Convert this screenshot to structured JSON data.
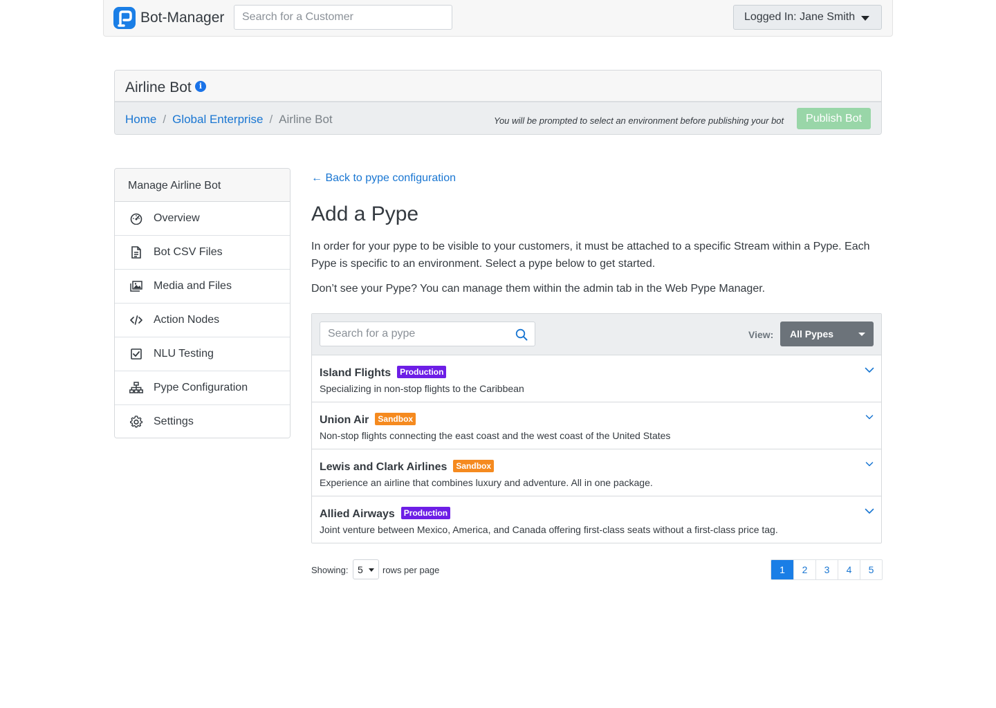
{
  "topbar": {
    "brand": "Bot-Manager",
    "search_placeholder": "Search for a Customer",
    "user_label": "Logged In: Jane Smith"
  },
  "header": {
    "title": "Airline Bot",
    "breadcrumb": [
      "Home",
      "Global Enterprise",
      "Airline Bot"
    ],
    "publish_note": "You will be prompted to select an environment before publishing your bot",
    "publish_label": "Publish Bot"
  },
  "sidebar": {
    "title": "Manage Airline Bot",
    "items": [
      {
        "label": "Overview",
        "icon": "gauge-icon"
      },
      {
        "label": "Bot CSV Files",
        "icon": "file-icon"
      },
      {
        "label": "Media and Files",
        "icon": "images-icon"
      },
      {
        "label": "Action Nodes",
        "icon": "code-icon"
      },
      {
        "label": "NLU Testing",
        "icon": "checkbox-icon"
      },
      {
        "label": "Pype Configuration",
        "icon": "sitemap-icon"
      },
      {
        "label": "Settings",
        "icon": "gear-icon"
      }
    ]
  },
  "main": {
    "back_label": "← Back to pype configuration",
    "title": "Add a Pype",
    "intro": "In order for your pype to be visible to your customers, it must be attached to a specific Stream within a Pype. Each Pype is specific to an environment. Select a pype below to get started.",
    "intro2": "Don’t see your Pype? You can manage them within the admin tab in the Web Pype Manager.",
    "search_placeholder": "Search for a pype",
    "view_label": "View:",
    "view_value": "All Pypes",
    "pypes": [
      {
        "name": "Island Flights",
        "env": "Production",
        "desc": "Specializing in non-stop flights to the Caribbean"
      },
      {
        "name": "Union Air",
        "env": "Sandbox",
        "desc": "Non-stop flights connecting the east coast and the west coast of the United States"
      },
      {
        "name": "Lewis and Clark Airlines",
        "env": "Sandbox",
        "desc": "Experience an airline that combines luxury and adventure. All in one package."
      },
      {
        "name": "Allied Airways",
        "env": "Production",
        "desc": "Joint venture between Mexico, America, and Canada offering first-class seats without a first-class price tag."
      }
    ],
    "showing_label": "Showing:",
    "rows_value": "5",
    "rows_label": "rows per page",
    "pages": [
      "1",
      "2",
      "3",
      "4",
      "5"
    ],
    "active_page": "1"
  },
  "colors": {
    "production": "#6d1ee6",
    "sandbox": "#f58a1f",
    "link": "#1976d2",
    "publish": "#99d6a8",
    "active_page": "#1a7ee6"
  }
}
